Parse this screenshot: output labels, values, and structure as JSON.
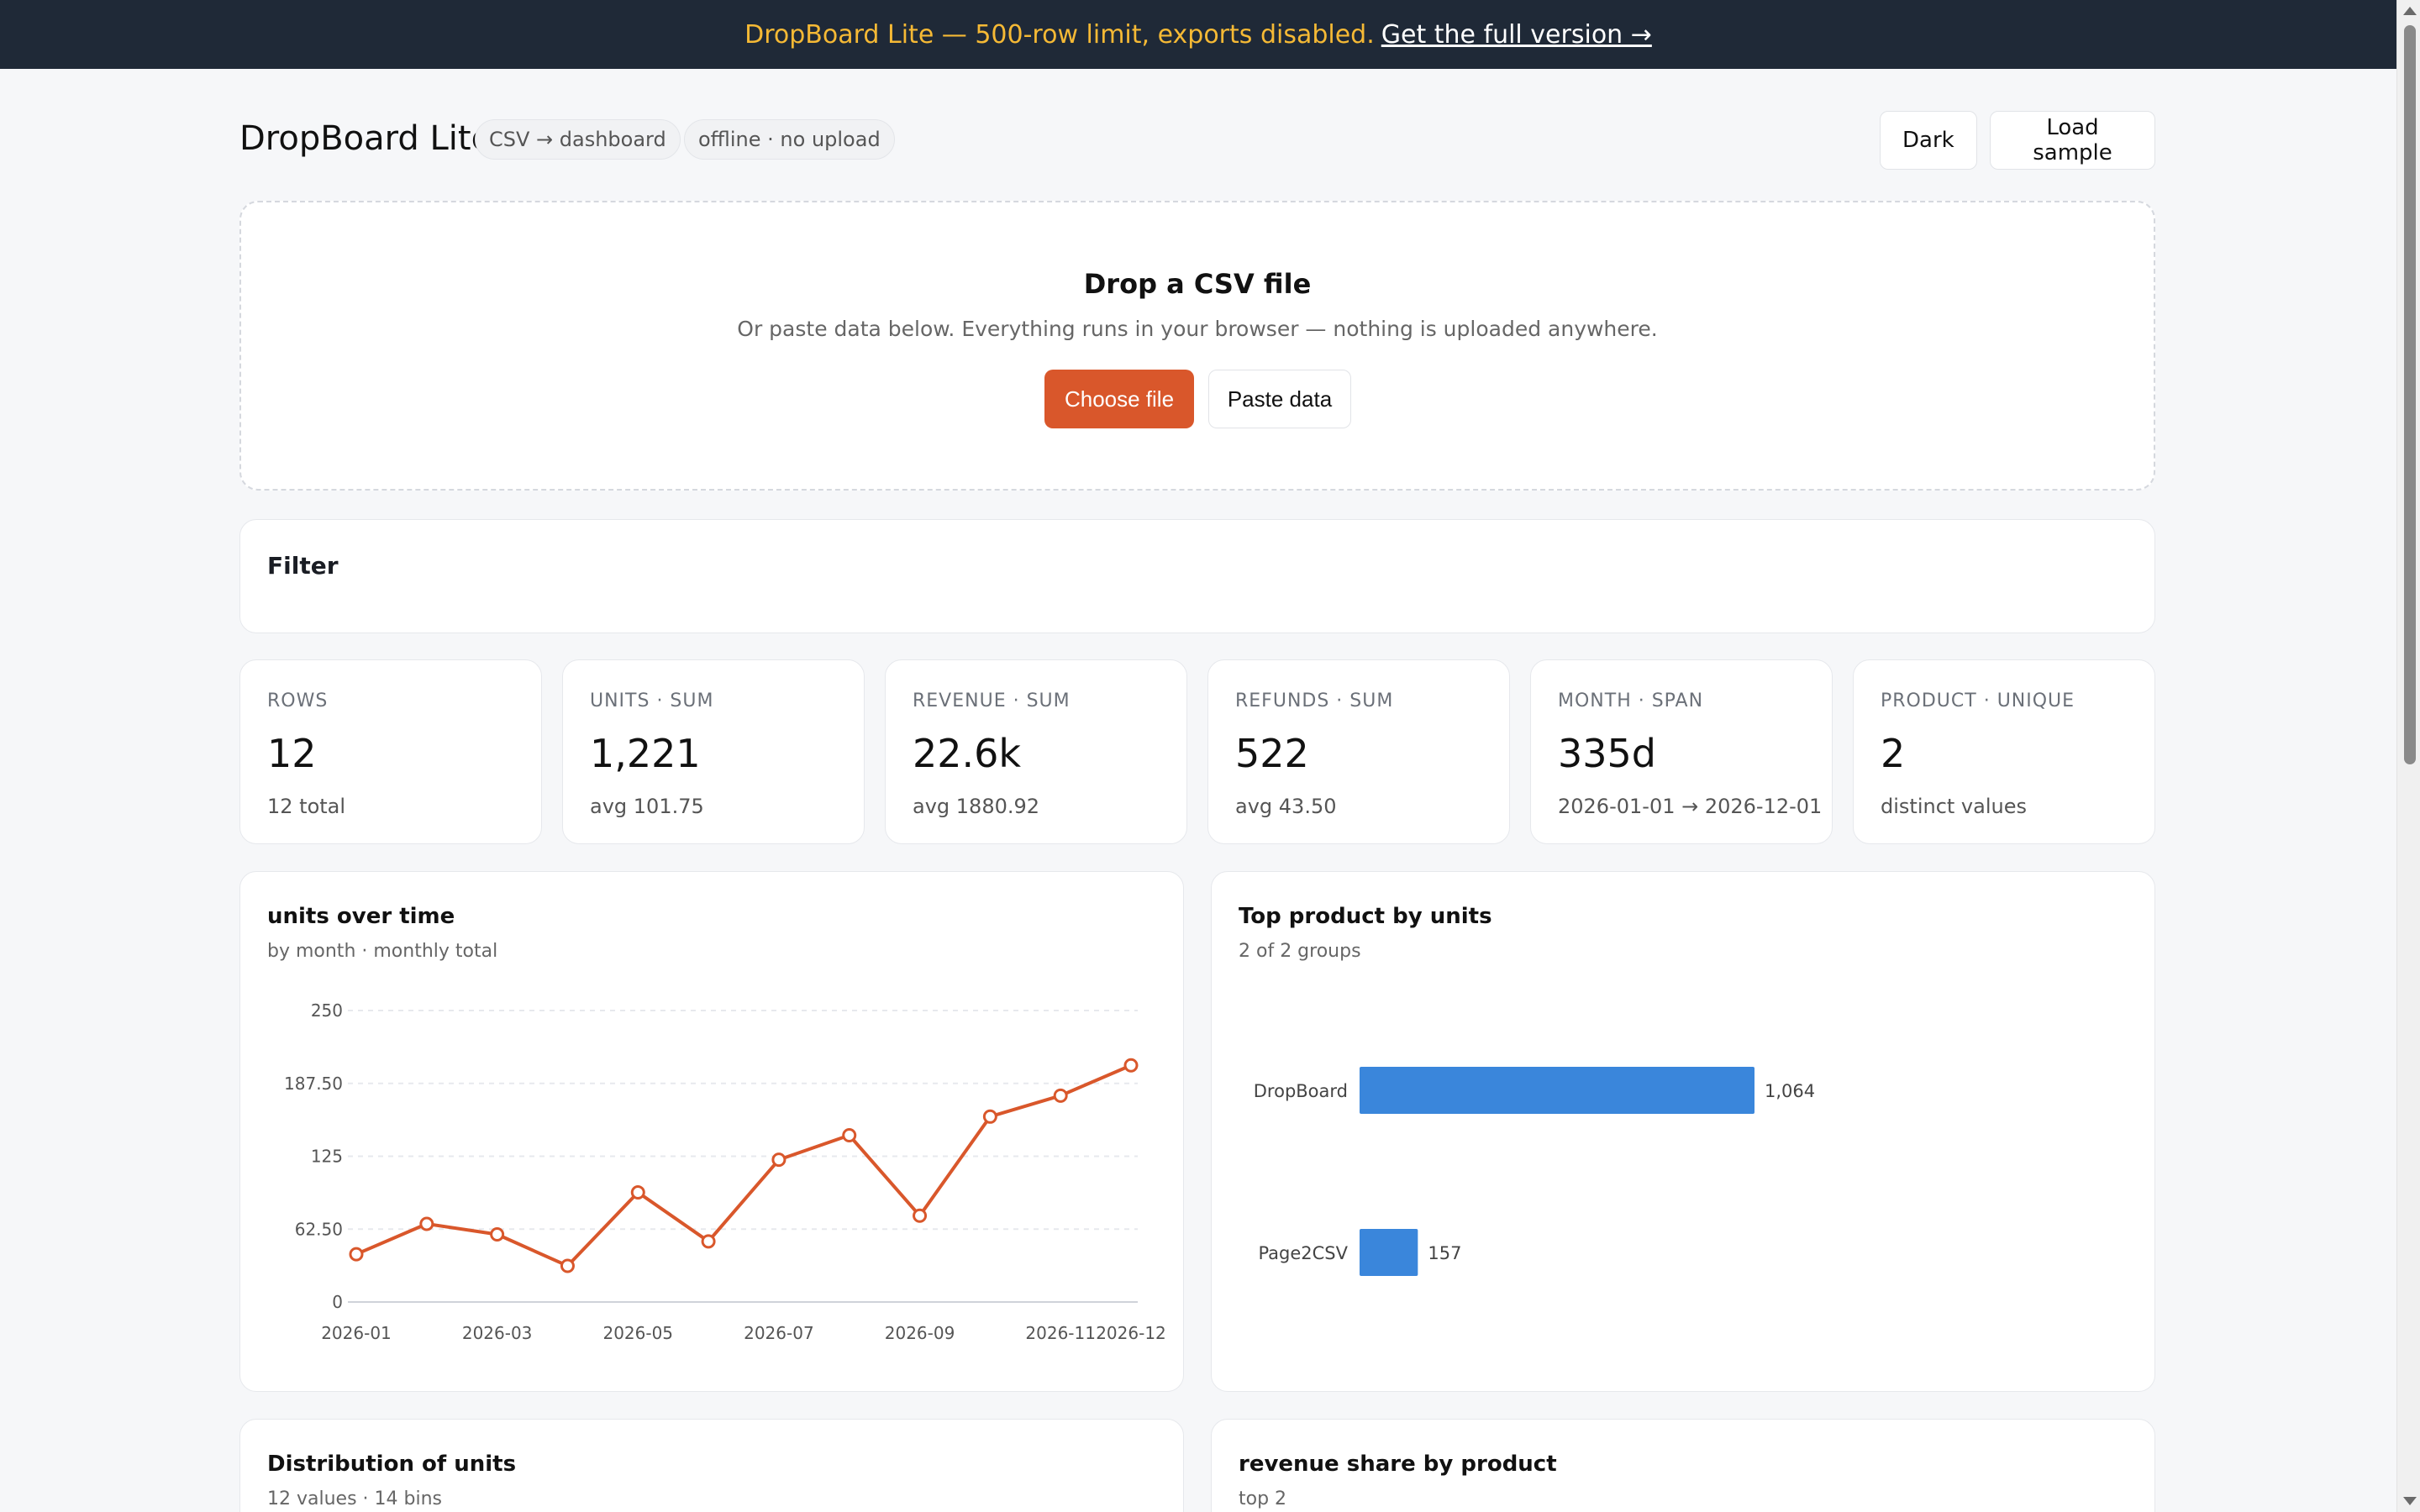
{
  "banner": {
    "text": "DropBoard Lite — 500-row limit, exports disabled.",
    "link": "Get the full version →"
  },
  "header": {
    "title": "DropBoard Lite",
    "pills": [
      "CSV → dashboard",
      "offline · no upload"
    ],
    "dark_label": "Dark",
    "load_sample_label": "Load sample"
  },
  "dropzone": {
    "title": "Drop a CSV file",
    "subtitle": "Or paste data below. Everything runs in your browser — nothing is uploaded anywhere.",
    "choose_label": "Choose file",
    "paste_label": "Paste data"
  },
  "filter": {
    "title": "Filter"
  },
  "stats": [
    {
      "label": "ROWS",
      "value": "12",
      "sub": "12 total"
    },
    {
      "label": "UNITS · SUM",
      "value": "1,221",
      "sub": "avg 101.75"
    },
    {
      "label": "REVENUE · SUM",
      "value": "22.6k",
      "sub": "avg 1880.92"
    },
    {
      "label": "REFUNDS · SUM",
      "value": "522",
      "sub": "avg 43.50"
    },
    {
      "label": "MONTH · SPAN",
      "value": "335d",
      "sub": "2026-01-01 → 2026-12-01"
    },
    {
      "label": "PRODUCT · UNIQUE",
      "value": "2",
      "sub": "distinct values"
    }
  ],
  "cards": {
    "line": {
      "title": "units over time",
      "sub": "by month · monthly total"
    },
    "bar": {
      "title": "Top product by units",
      "sub": "2 of 2 groups"
    },
    "hist": {
      "title": "Distribution of units",
      "sub": "12 values · 14 bins"
    },
    "pie": {
      "title": "revenue share by product",
      "sub": "top 2"
    }
  },
  "colors": {
    "accent": "#d9572b",
    "bar": "#3a86db",
    "banner_bg": "#1f2937",
    "banner_text": "#f5b935"
  },
  "chart_data": [
    {
      "type": "line",
      "title": "units over time",
      "x": [
        "2026-01",
        "2026-02",
        "2026-03",
        "2026-04",
        "2026-05",
        "2026-06",
        "2026-07",
        "2026-08",
        "2026-09",
        "2026-10",
        "2026-11",
        "2026-12"
      ],
      "x_tick_labels": [
        "2026-01",
        "2026-03",
        "2026-05",
        "2026-07",
        "2026-09",
        "2026-11",
        "2026-12"
      ],
      "values": [
        41,
        67,
        58,
        31,
        94,
        52,
        122,
        143,
        74,
        159,
        177,
        203
      ],
      "y_ticks": [
        "0",
        "62.50",
        "125",
        "187.50",
        "250"
      ],
      "ylim": [
        0,
        250
      ]
    },
    {
      "type": "bar",
      "title": "Top product by units",
      "orientation": "horizontal",
      "categories": [
        "DropBoard",
        "Page2CSV"
      ],
      "values": [
        1064,
        157
      ],
      "value_labels": [
        "1,064",
        "157"
      ]
    }
  ]
}
